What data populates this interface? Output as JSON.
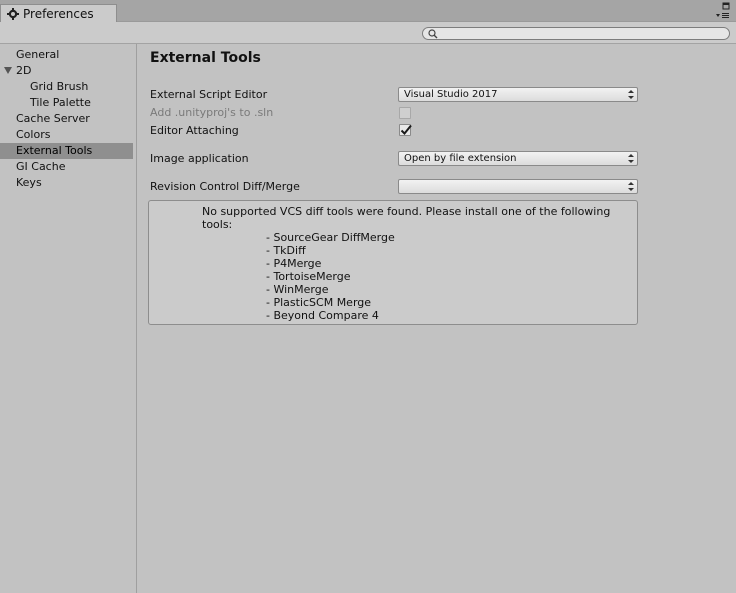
{
  "window": {
    "tab_title": "Preferences"
  },
  "search": {
    "placeholder": ""
  },
  "sidebar": {
    "items": [
      {
        "label": "General"
      },
      {
        "label": "2D"
      },
      {
        "label": "Grid Brush"
      },
      {
        "label": "Tile Palette"
      },
      {
        "label": "Cache Server"
      },
      {
        "label": "Colors"
      },
      {
        "label": "External Tools"
      },
      {
        "label": "GI Cache"
      },
      {
        "label": "Keys"
      }
    ],
    "selected": "External Tools"
  },
  "main": {
    "title": "External Tools",
    "external_script_editor": {
      "label": "External Script Editor",
      "value": "Visual Studio 2017"
    },
    "add_unityproj": {
      "label": "Add .unityproj's to .sln",
      "checked": false,
      "enabled": false
    },
    "editor_attaching": {
      "label": "Editor Attaching",
      "checked": true
    },
    "image_application": {
      "label": "Image application",
      "value": "Open by file extension"
    },
    "revision_control": {
      "label": "Revision Control Diff/Merge",
      "value": ""
    },
    "vcs_box": {
      "message_line1": "No supported VCS diff tools were found. Please install one of the following",
      "message_line2": "tools:",
      "tools": [
        "- SourceGear DiffMerge",
        "- TkDiff",
        "- P4Merge",
        "- TortoiseMerge",
        "- WinMerge",
        "- PlasticSCM Merge",
        "- Beyond Compare 4"
      ]
    }
  },
  "icons": {
    "tab": "gear-icon",
    "search": "search-icon",
    "window_controls": [
      "maximize-icon",
      "menu-icon"
    ],
    "dropdown": "dropdown-arrows-icon",
    "checkbox": "checkmark-icon",
    "tree_toggle": "triangle-down-icon"
  },
  "colors": {
    "background": "#c2c2c2",
    "selected_item": "#8f8f8f",
    "titlebar": "#a5a5a5"
  }
}
